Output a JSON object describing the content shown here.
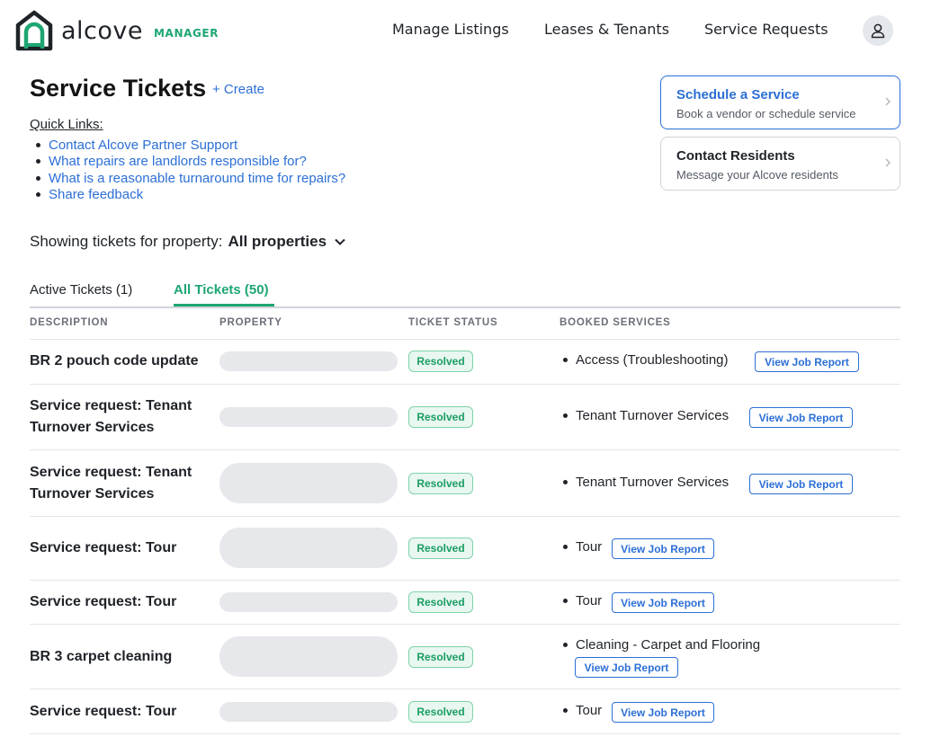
{
  "header": {
    "logo_word": "alcove",
    "logo_sub": "MANAGER",
    "nav": [
      "Manage Listings",
      "Leases & Tenants",
      "Service Requests"
    ],
    "avatar_icon": "user-icon"
  },
  "page": {
    "title": "Service Tickets",
    "create_label": "+ Create"
  },
  "quick_links": {
    "title": "Quick Links:",
    "items": [
      "Contact Alcove Partner Support",
      "What repairs are landlords responsible for?",
      "What is a reasonable turnaround time for repairs?",
      "Share feedback"
    ]
  },
  "cards": [
    {
      "title": "Schedule a Service",
      "subtitle": "Book a vendor or schedule service"
    },
    {
      "title": "Contact Residents",
      "subtitle": "Message your Alcove residents"
    }
  ],
  "filter": {
    "label": "Showing tickets for property:",
    "value": "All properties"
  },
  "tabs": [
    "Active Tickets (1)",
    "All Tickets (50)"
  ],
  "table": {
    "headers": [
      "DESCRIPTION",
      "PROPERTY",
      "TICKET STATUS",
      "BOOKED SERVICES"
    ],
    "rows": [
      {
        "description": "BR 2 pouch code update",
        "status": "Resolved",
        "service": "Access (Troubleshooting)",
        "action": "View Job Report"
      },
      {
        "description": "Service request: Tenant Turnover Services",
        "status": "Resolved",
        "service": "Tenant Turnover Services",
        "action": "View Job Report"
      },
      {
        "description": "Service request: Tenant Turnover Services",
        "status": "Resolved",
        "service": "Tenant Turnover Services",
        "action": "View Job Report"
      },
      {
        "description": "Service request: Tour",
        "status": "Resolved",
        "service": "Tour",
        "action": "View Job Report"
      },
      {
        "description": "Service request: Tour",
        "status": "Resolved",
        "service": "Tour",
        "action": "View Job Report"
      },
      {
        "description": "BR 3 carpet cleaning",
        "status": "Resolved",
        "service": "Cleaning - Carpet and Flooring",
        "action": "View Job Report"
      },
      {
        "description": "Service request: Tour",
        "status": "Resolved",
        "service": "Tour",
        "action": "View Job Report"
      }
    ]
  },
  "colors": {
    "brand_green": "#1ea672",
    "link_blue": "#2c6fd6",
    "resolved_bg": "#e8f7ef"
  }
}
